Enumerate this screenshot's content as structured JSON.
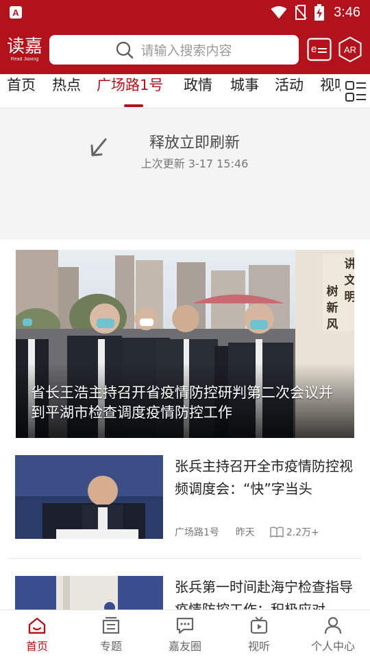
{
  "status_bar": {
    "time": "3:46",
    "app_badge": "A"
  },
  "header": {
    "logo_text": "读嘉",
    "logo_subtext": "Read Jiaxing",
    "search_placeholder": "请输入搜索内容",
    "ar_label": "AR"
  },
  "tabs": [
    {
      "label": "首页",
      "active": false
    },
    {
      "label": "热点",
      "active": false
    },
    {
      "label": "广场路1号",
      "active": true
    },
    {
      "label": "政情",
      "active": false
    },
    {
      "label": "城事",
      "active": false
    },
    {
      "label": "活动",
      "active": false
    },
    {
      "label": "视听",
      "active": false
    }
  ],
  "refresh": {
    "title": "释放立即刷新",
    "last_update": "上次更新 3-17 15:46"
  },
  "feature": {
    "title": "省长王浩主持召开省疫情防控研判第二次会议并到平湖市检查调度疫情防控工作",
    "sign_text": "讲文明树新风"
  },
  "articles": [
    {
      "title": "张兵主持召开全市疫情防控视频调度会：“快”字当头",
      "source": "广场路1号",
      "time": "昨天",
      "views": "2.2万+"
    },
    {
      "title": "张兵第一时间赴海宁检查指导疫情防控工作：积极应对",
      "source": "",
      "time": "",
      "views": ""
    }
  ],
  "bottom_nav": [
    {
      "label": "首页",
      "icon": "home-icon",
      "active": true
    },
    {
      "label": "专题",
      "icon": "topic-icon",
      "active": false
    },
    {
      "label": "嘉友圈",
      "icon": "chat-icon",
      "active": false
    },
    {
      "label": "视听",
      "icon": "tv-icon",
      "active": false
    },
    {
      "label": "个人中心",
      "icon": "user-icon",
      "active": false
    }
  ],
  "colors": {
    "brand": "#b2121b",
    "muted": "#777777",
    "refresh_bg": "#f4f4f4"
  }
}
